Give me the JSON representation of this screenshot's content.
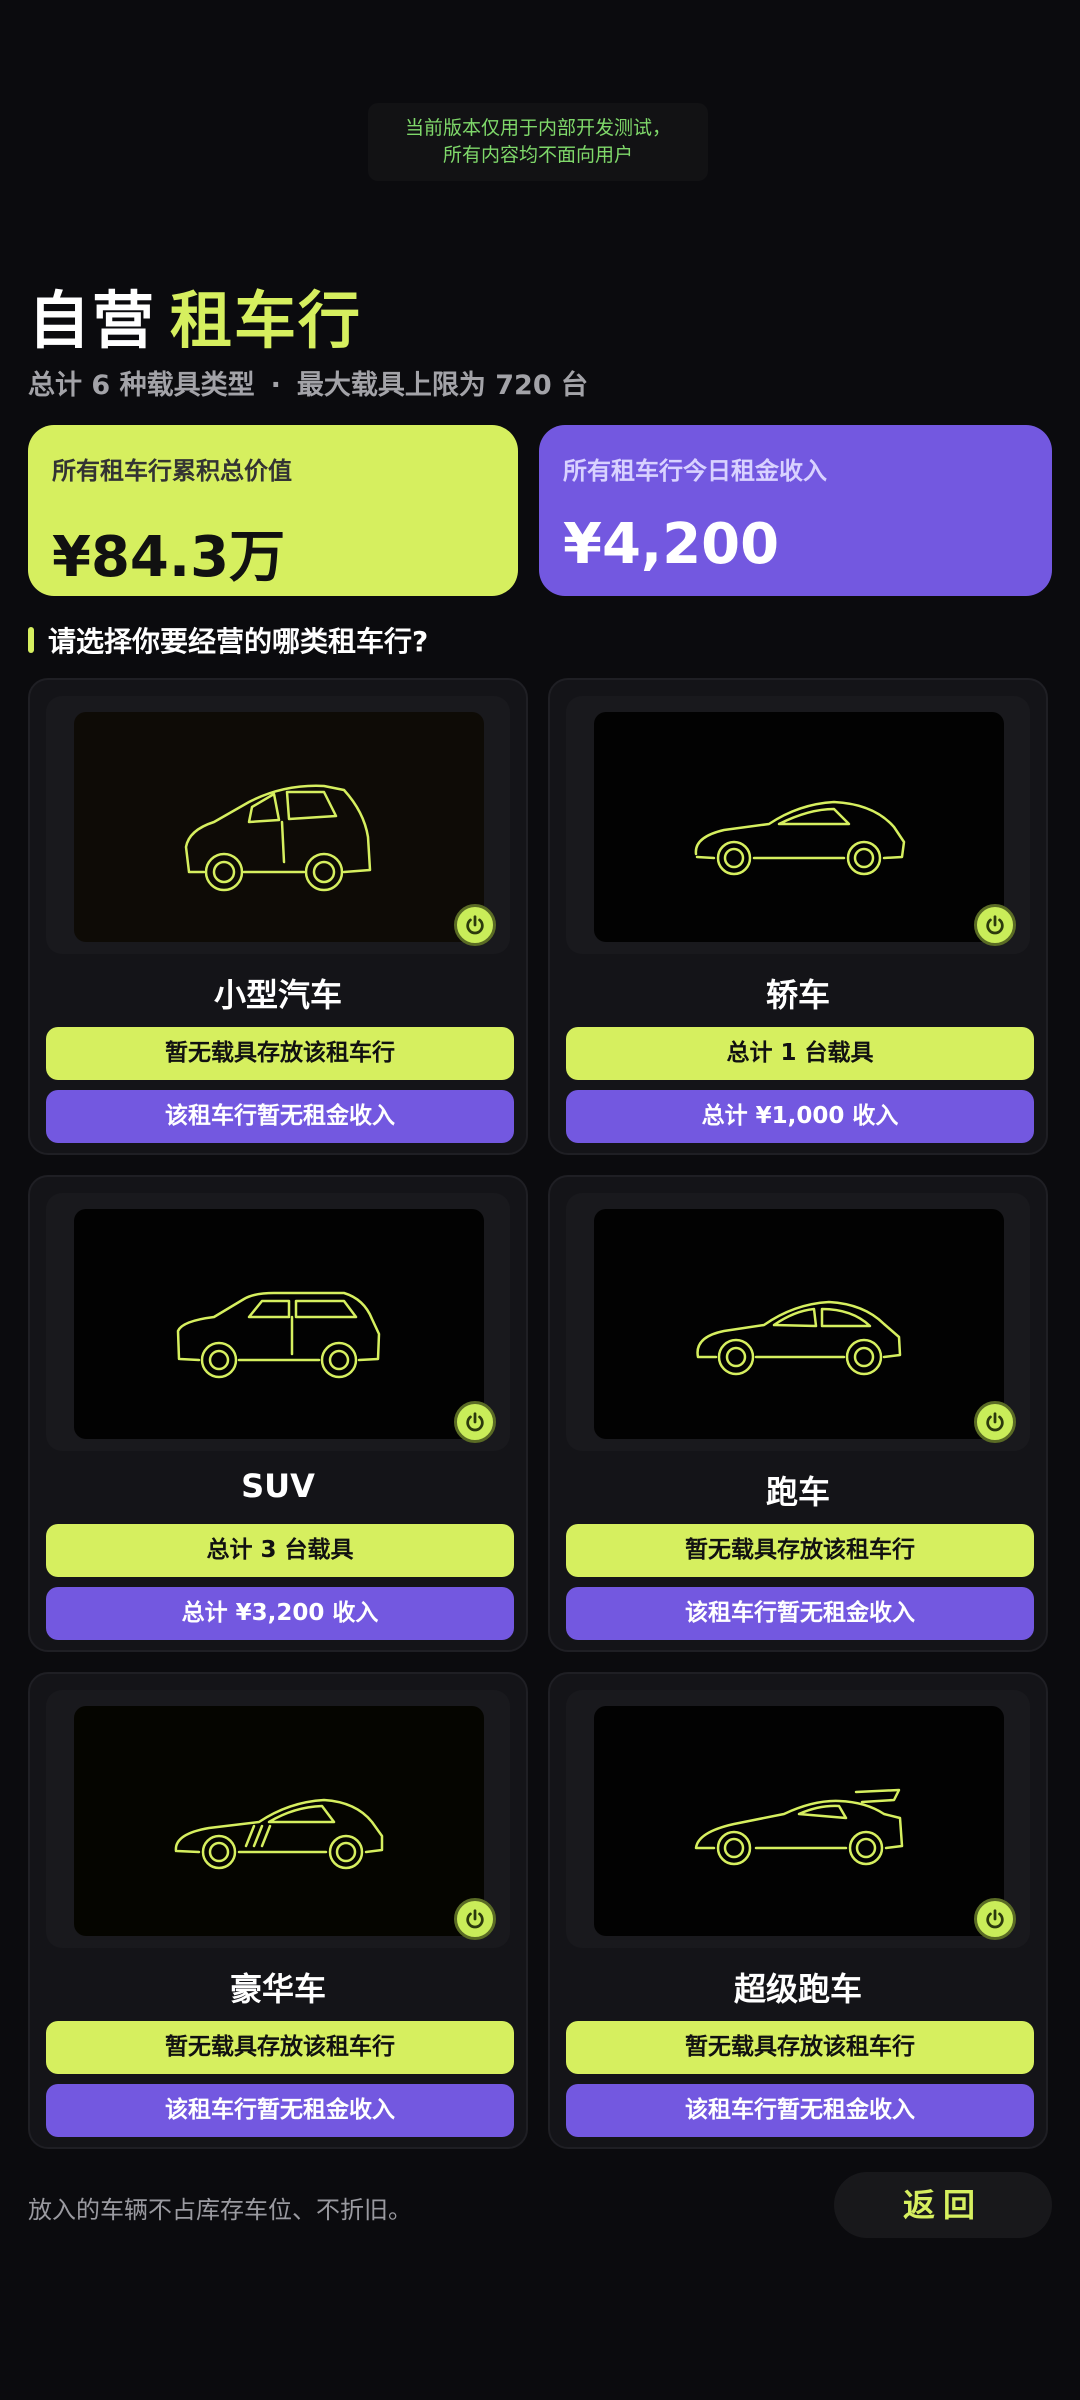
{
  "notice": {
    "line1": "当前版本仅用于内部开发测试，",
    "line2": "所有内容均不面向用户"
  },
  "header": {
    "title_main": "自营",
    "title_accent": "租车行",
    "subtitle_left": "总计 6 种载具类型",
    "subtitle_sep": "·",
    "subtitle_right": "最大载具上限为 720 台"
  },
  "stats": {
    "total_value_label": "所有租车行累积总价值",
    "total_value": "¥84.3万",
    "today_income_label": "所有租车行今日租金收入",
    "today_income": "¥4,200"
  },
  "question": "请选择你要经营的哪类租车行?",
  "cards": [
    {
      "name": "小型汽车",
      "vehicles": "暂无载具存放该租车行",
      "income": "该租车行暂无租金收入",
      "icon": "compact-car-icon"
    },
    {
      "name": "轿车",
      "vehicles": "总计 1 台载具",
      "income": "总计 ¥1,000 收入",
      "icon": "coupe-icon"
    },
    {
      "name": "SUV",
      "vehicles": "总计 3 台载具",
      "income": "总计 ¥3,200 收入",
      "icon": "suv-icon"
    },
    {
      "name": "跑车",
      "vehicles": "暂无载具存放该租车行",
      "income": "该租车行暂无租金收入",
      "icon": "sedan-icon"
    },
    {
      "name": "豪华车",
      "vehicles": "暂无载具存放该租车行",
      "income": "该租车行暂无租金收入",
      "icon": "luxury-car-icon"
    },
    {
      "name": "超级跑车",
      "vehicles": "暂无载具存放该租车行",
      "income": "该租车行暂无租金收入",
      "icon": "supercar-icon"
    }
  ],
  "footer": {
    "note": "放入的车辆不占库存车位、不折旧。",
    "back_label": "返回"
  },
  "colors": {
    "accent_green": "#d6ef5f",
    "accent_purple": "#7358e0",
    "background": "#0b0b0e"
  }
}
